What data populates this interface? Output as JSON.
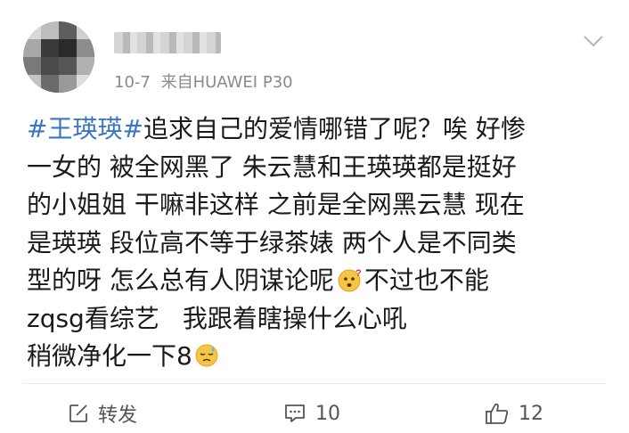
{
  "post": {
    "date": "10-7",
    "source": "来自HUAWEI P30",
    "content": {
      "line1_hashtag": "#王瑛瑛#",
      "line1_text": "追求自己的爱情哪错了呢？唉 好惨",
      "line2": "一女的 被全网黑了 朱云慧和王瑛瑛都是挺好",
      "line3": "的小姐姐 干嘛非这样 之前是全网黑云慧 现在",
      "line4": "是瑛瑛 段位高不等于绿茶婊 两个人是不同类",
      "line5_a": "型的呀 怎么总有人阴谋论呢",
      "line5_b": "不过也不能",
      "line6_a": "zqsg看综艺",
      "line6_b": "我跟着瞎操什么心吼",
      "line7": "稍微净化一下8"
    },
    "emojis": [
      "confused-face-emoji",
      "sleepy-sweat-face-emoji"
    ]
  },
  "actions": {
    "repost_label": "转发",
    "comment_count": "10",
    "like_count": "12"
  },
  "colors": {
    "hashtag": "#3b75c6",
    "meta": "#8a8a8a",
    "action": "#555555"
  }
}
